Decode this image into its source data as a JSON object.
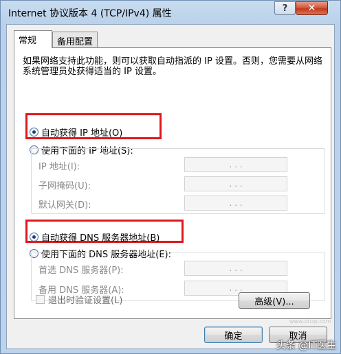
{
  "window": {
    "title": "Internet 协议版本 4 (TCP/IPv4) 属性",
    "help_label": "?",
    "close_label": "✕"
  },
  "tabs": [
    {
      "label": "常规",
      "active": true
    },
    {
      "label": "备用配置",
      "active": false
    }
  ],
  "description": "如果网络支持此功能，则可以获取自动指派的 IP 设置。否则，您需要从网络系统管理员处获得适当的 IP 设置。",
  "ip_section": {
    "auto_label": "自动获得 IP 地址(O)",
    "auto_checked": true,
    "manual_label": "使用下面的 IP 地址(S):",
    "manual_checked": false,
    "fields": [
      {
        "label": "IP 地址(I):",
        "value": ". . ."
      },
      {
        "label": "子网掩码(U):",
        "value": ". . ."
      },
      {
        "label": "默认网关(D):",
        "value": ". . ."
      }
    ]
  },
  "dns_section": {
    "auto_label": "自动获得 DNS 服务器地址(B)",
    "auto_checked": true,
    "manual_label": "使用下面的 DNS 服务器地址(E):",
    "manual_checked": false,
    "fields": [
      {
        "label": "首选 DNS 服务器(P):",
        "value": ". . ."
      },
      {
        "label": "备用 DNS 服务器(A):",
        "value": ". . ."
      }
    ]
  },
  "validate_label": "退出时验证设置(L)",
  "validate_checked": false,
  "buttons": {
    "advanced": "高级(V)...",
    "ok": "确定",
    "cancel": "取消"
  },
  "watermark": "头条 @IT医生",
  "site_mark": "www.dnzp.com",
  "colors": {
    "highlight_border": "#e0161b",
    "radio_dot": "#1d3f7d"
  }
}
